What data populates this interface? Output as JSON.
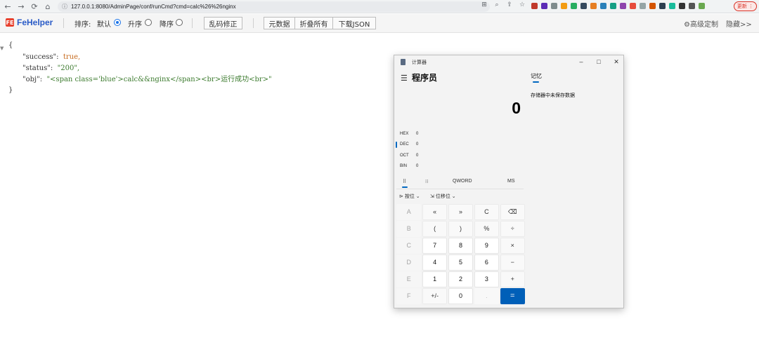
{
  "browser": {
    "url": "127.0.0.1:8080/AdminPage/conf/runCmd?cmd=calc%26%26nginx",
    "update_label": "更新 ⋮",
    "nav_icons": [
      "back-icon",
      "forward-icon",
      "reload-icon",
      "home-icon",
      "info-icon"
    ]
  },
  "fehelper": {
    "logo_text": "FE",
    "title": "FeHelper",
    "sort_label": "排序:",
    "sort_default": "默认",
    "sort_asc": "升序",
    "sort_desc": "降序",
    "selected_sort": "默认",
    "fix_garbled": "乱码修正",
    "raw_data": "元数据",
    "collapse_all": "折叠所有",
    "download_json": "下载JSON",
    "advanced": "⚙高级定制",
    "hide": "隐藏>>"
  },
  "json": {
    "open_brace": "{",
    "close_brace": "}",
    "collapse_marker": "▼",
    "success_key": "\"success\":",
    "success_value": "true,",
    "status_key": "\"status\":",
    "status_value": "\"200\",",
    "obj_key": "\"obj\":",
    "obj_value": "\"<span class='blue'>calc&&nginx</span><br>运行成功<br>\""
  },
  "calculator": {
    "window_title": "计算器",
    "mode": "程序员",
    "display_value": "0",
    "memory_tab": "记忆",
    "memory_empty": "存储器中未保存数据",
    "radix": [
      {
        "name": "HEX",
        "value": "0"
      },
      {
        "name": "DEC",
        "value": "0"
      },
      {
        "name": "OCT",
        "value": "0"
      },
      {
        "name": "BIN",
        "value": "0"
      }
    ],
    "word_size": "QWORD",
    "ms_label": "MS",
    "bitwise_label": "按位",
    "bitshift_label": "位移位",
    "keys": [
      {
        "label": "A",
        "kind": "light"
      },
      {
        "label": "«",
        "kind": "op"
      },
      {
        "label": "»",
        "kind": "op"
      },
      {
        "label": "C",
        "kind": "op"
      },
      {
        "label": "⌫",
        "kind": "op"
      },
      {
        "label": "B",
        "kind": "light"
      },
      {
        "label": "(",
        "kind": "op"
      },
      {
        "label": ")",
        "kind": "op"
      },
      {
        "label": "%",
        "kind": "op"
      },
      {
        "label": "÷",
        "kind": "op"
      },
      {
        "label": "C",
        "kind": "light"
      },
      {
        "label": "7",
        "kind": "num"
      },
      {
        "label": "8",
        "kind": "num"
      },
      {
        "label": "9",
        "kind": "num"
      },
      {
        "label": "×",
        "kind": "op"
      },
      {
        "label": "D",
        "kind": "light"
      },
      {
        "label": "4",
        "kind": "num"
      },
      {
        "label": "5",
        "kind": "num"
      },
      {
        "label": "6",
        "kind": "num"
      },
      {
        "label": "−",
        "kind": "op"
      },
      {
        "label": "E",
        "kind": "light"
      },
      {
        "label": "1",
        "kind": "num"
      },
      {
        "label": "2",
        "kind": "num"
      },
      {
        "label": "3",
        "kind": "num"
      },
      {
        "label": "+",
        "kind": "op"
      },
      {
        "label": "F",
        "kind": "light"
      },
      {
        "label": "+/-",
        "kind": "op"
      },
      {
        "label": "0",
        "kind": "num"
      },
      {
        "label": ".",
        "kind": "disabled"
      },
      {
        "label": "=",
        "kind": "equals"
      }
    ]
  },
  "colors": {
    "accent": "#0067c0",
    "equals": "#005fb8",
    "fe_title": "#2b5cc7",
    "json_bool": "#c76b1e",
    "json_string": "#3b7a2d"
  }
}
